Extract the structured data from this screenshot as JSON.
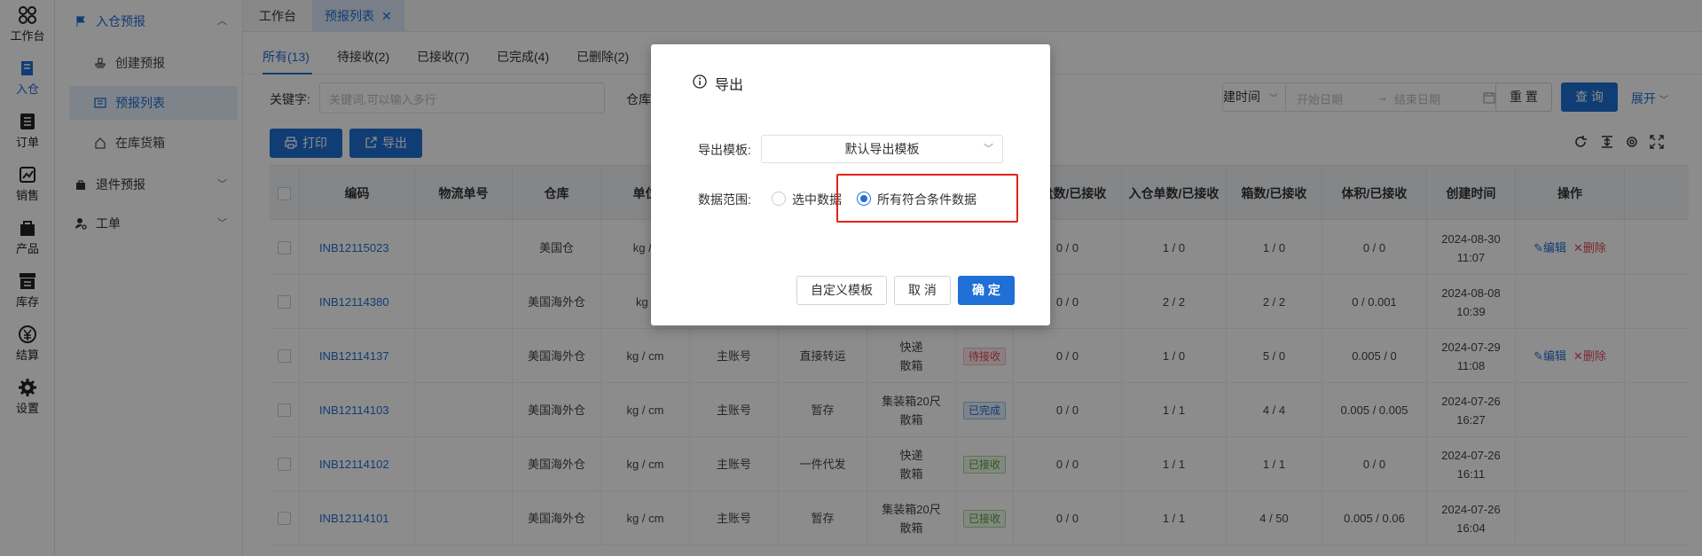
{
  "rail": [
    {
      "label": "工作台",
      "icon": "workbench-icon"
    },
    {
      "label": "入仓",
      "icon": "inbound-icon"
    },
    {
      "label": "订单",
      "icon": "order-icon"
    },
    {
      "label": "销售",
      "icon": "sales-icon"
    },
    {
      "label": "产品",
      "icon": "product-icon"
    },
    {
      "label": "库存",
      "icon": "inventory-icon"
    },
    {
      "label": "结算",
      "icon": "settlement-icon"
    },
    {
      "label": "设置",
      "icon": "settings-icon"
    }
  ],
  "submenu": {
    "group_inbound": "入仓预报",
    "items": [
      "创建预报",
      "预报列表",
      "在库货箱"
    ],
    "group_return": "退件预报",
    "group_ticket": "工单"
  },
  "toptabs": {
    "workbench": "工作台",
    "current": "预报列表",
    "close": "✕"
  },
  "subtabs": [
    "所有(13)",
    "待接收(2)",
    "已接收(7)",
    "已完成(4)",
    "已删除(2)"
  ],
  "filters": {
    "keyword_label": "关键字:",
    "keyword_placeholder": "关键词,可以输入多行",
    "warehouse_label": "仓库",
    "time_select": "建时间",
    "start_placeholder": "开始日期",
    "arrow": "→",
    "end_placeholder": "结束日期"
  },
  "buttons": {
    "reset": "重 置",
    "query": "查 询",
    "expand": "展开",
    "print": "打印",
    "export": "导出"
  },
  "table": {
    "headers": [
      "编码",
      "物流单号",
      "仓库",
      "单位",
      "",
      "",
      "",
      "",
      "托盘数/已接收",
      "入仓单数/已接收",
      "箱数/已接收",
      "体积/已接收",
      "创建时间",
      "操作"
    ],
    "rows": [
      {
        "code": "INB12115023",
        "warehouse": "美国仓",
        "unit": "kg / i",
        "account": "",
        "mode": "",
        "ship": "",
        "ship2": "",
        "status": "",
        "status_type": "",
        "pallet": "0 / 0",
        "orders": "1 / 0",
        "boxes": "1 / 0",
        "volume": "0 / 0",
        "date": "2024-08-30",
        "time": "11:07",
        "edit": "编辑",
        "del": "删除"
      },
      {
        "code": "INB12114380",
        "warehouse": "美国海外仓",
        "unit": "kg /",
        "account": "",
        "mode": "",
        "ship": "",
        "ship2": "",
        "status": "",
        "status_type": "",
        "pallet": "0 / 0",
        "orders": "2 / 2",
        "boxes": "2 / 2",
        "volume": "0 / 0.001",
        "date": "2024-08-08",
        "time": "10:39",
        "edit": "",
        "del": ""
      },
      {
        "code": "INB12114137",
        "warehouse": "美国海外仓",
        "unit": "kg / cm",
        "account": "主账号",
        "mode": "直接转运",
        "ship": "快递",
        "ship2": "散箱",
        "status": "待接收",
        "status_type": "pending",
        "pallet": "0 / 0",
        "orders": "1 / 0",
        "boxes": "5 / 0",
        "volume": "0.005 / 0",
        "date": "2024-07-29",
        "time": "11:08",
        "edit": "编辑",
        "del": "删除"
      },
      {
        "code": "INB12114103",
        "warehouse": "美国海外仓",
        "unit": "kg / cm",
        "account": "主账号",
        "mode": "暂存",
        "ship": "集装箱20尺",
        "ship2": "散箱",
        "status": "已完成",
        "status_type": "done",
        "pallet": "0 / 0",
        "orders": "1 / 1",
        "boxes": "4 / 4",
        "volume": "0.005 / 0.005",
        "date": "2024-07-26",
        "time": "16:27",
        "edit": "",
        "del": ""
      },
      {
        "code": "INB12114102",
        "warehouse": "美国海外仓",
        "unit": "kg / cm",
        "account": "主账号",
        "mode": "一件代发",
        "ship": "快递",
        "ship2": "散箱",
        "status": "已接收",
        "status_type": "recv",
        "pallet": "0 / 0",
        "orders": "1 / 1",
        "boxes": "1 / 1",
        "volume": "0 / 0",
        "date": "2024-07-26",
        "time": "16:11",
        "edit": "",
        "del": ""
      },
      {
        "code": "INB12114101",
        "warehouse": "美国海外仓",
        "unit": "kg / cm",
        "account": "主账号",
        "mode": "暂存",
        "ship": "集装箱20尺",
        "ship2": "散箱",
        "status": "已接收",
        "status_type": "recv",
        "pallet": "0 / 0",
        "orders": "1 / 1",
        "boxes": "4 / 50",
        "volume": "0.005 / 0.06",
        "date": "2024-07-26",
        "time": "16:04",
        "edit": "",
        "del": ""
      }
    ]
  },
  "modal": {
    "title": "导出",
    "template_label": "导出模板:",
    "template_value": "默认导出模板",
    "range_label": "数据范围:",
    "option_selected": "选中数据",
    "option_all": "所有符合条件数据",
    "selected_option": "all",
    "custom_template": "自定义模板",
    "cancel": "取 消",
    "confirm": "确 定"
  },
  "colors": {
    "primary": "#1f6fd6",
    "danger": "#e2231a",
    "pending": "#e0485b",
    "received": "#52a23a"
  }
}
